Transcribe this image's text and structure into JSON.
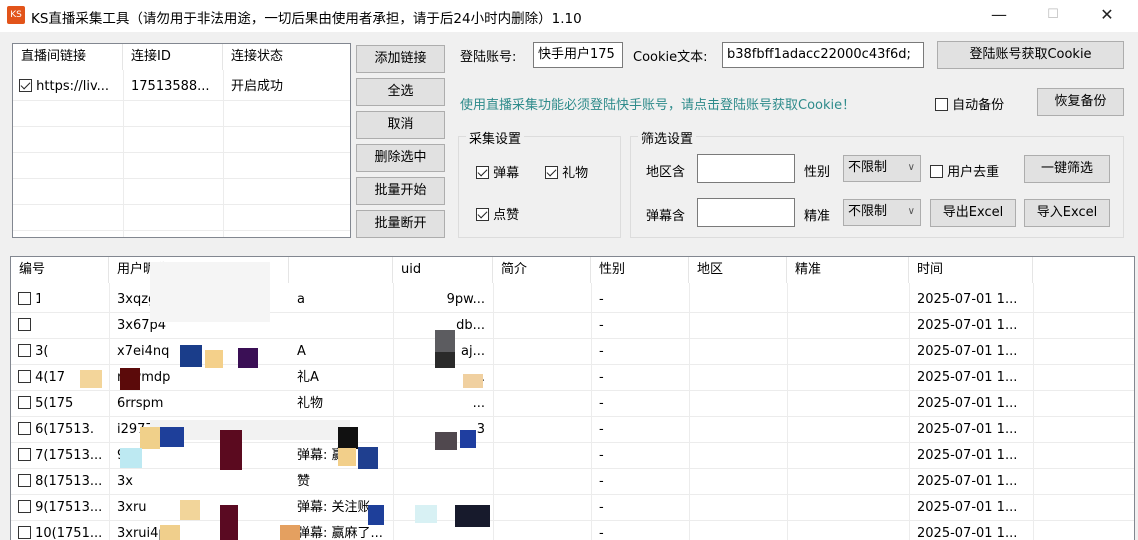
{
  "window": {
    "title": "KS直播采集工具（请勿用于非法用途，一切后果由使用者承担，请于后24小时内删除）1.10",
    "icon_text": "KS",
    "minimize": "—",
    "maximize": "☐",
    "close": "✕"
  },
  "room_list": {
    "headers": [
      "直播间链接",
      "连接ID",
      "连接状态"
    ],
    "rows": [
      {
        "link": "https://liv...",
        "id": "17513588...",
        "status": "开启成功",
        "checked": true
      }
    ]
  },
  "room_buttons": {
    "add": "添加链接",
    "select_all": "全选",
    "cancel": "取消",
    "delete": "删除选中",
    "batch_start": "批量开始",
    "batch_stop": "批量断开"
  },
  "account": {
    "label": "登陆账号:",
    "value": "快手用户175",
    "cookie_label": "Cookie文本:",
    "cookie_value": "b38fbff1adacc22000c43f6d;",
    "get_cookie": "登陆账号获取Cookie",
    "hint": "使用直播采集功能必须登陆快手账号，请点击登陆账号获取Cookie！",
    "hint_color": "#2e8b8b",
    "auto_backup": "自动备份",
    "restore_backup": "恢复备份"
  },
  "collect": {
    "title": "采集设置",
    "danmu": "弹幕",
    "gift": "礼物",
    "like": "点赞"
  },
  "filter": {
    "title": "筛选设置",
    "region_label": "地区含",
    "danmu_label": "弹幕含",
    "gender_label": "性别",
    "gender_value": "不限制",
    "precise_label": "精准",
    "precise_value": "不限制",
    "dedupe": "用户去重",
    "one_click": "一键筛选",
    "export": "导出Excel",
    "import": "导入Excel"
  },
  "results": {
    "headers": [
      "编号",
      "用户昵称",
      "",
      "uid",
      "简介",
      "性别",
      "地区",
      "精准",
      "时间"
    ],
    "rows": [
      {
        "no": "1",
        "nick": "3xqzg",
        "content": "a",
        "uid": "9pw...",
        "gender": "-",
        "time": "2025-07-01 1..."
      },
      {
        "no": "",
        "nick": "3x67p4",
        "content": "",
        "uid": "db...",
        "gender": "-",
        "time": "2025-07-01 1..."
      },
      {
        "no": "3(",
        "nick": "x7ei4nq",
        "content": "A",
        "uid": "aj...",
        "gender": "-",
        "time": "2025-07-01 1..."
      },
      {
        "no": "4(17",
        "nick": "r4wmdp",
        "content": "礼A",
        "uid": "...",
        "gender": "-",
        "time": "2025-07-01 1..."
      },
      {
        "no": "5(175",
        "nick": "6rrspm",
        "content": "礼物",
        "uid": "...",
        "gender": "-",
        "time": "2025-07-01 1..."
      },
      {
        "no": "6(17513.",
        "nick": "i2977",
        "content": "弹幕: L",
        "uid": "3",
        "gender": "-",
        "time": "2025-07-01 1..."
      },
      {
        "no": "7(17513...",
        "nick": "977",
        "content": "弹幕: 赢",
        "uid": "",
        "gender": "-",
        "time": "2025-07-01 1..."
      },
      {
        "no": "8(17513...",
        "nick": "3x",
        "content": "赞",
        "uid": "",
        "gender": "-",
        "time": "2025-07-01 1..."
      },
      {
        "no": "9(17513...",
        "nick": "3xru",
        "content": "弹幕: 关注账",
        "uid": "",
        "gender": "-",
        "time": "2025-07-01 1..."
      },
      {
        "no": "10(1751...",
        "nick": "3xrui4p",
        "content": "弹幕: 赢麻了...",
        "uid": "",
        "gender": "-",
        "time": "2025-07-01 1..."
      }
    ]
  }
}
